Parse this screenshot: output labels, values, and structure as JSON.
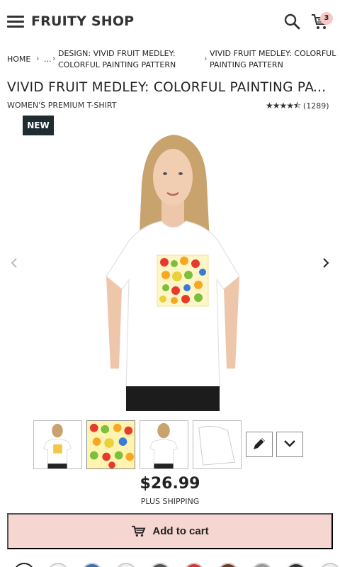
{
  "header": {
    "brand": "FRUITY SHOP",
    "cart_count": "3",
    "icons": [
      "hamburger-menu-icon",
      "search-icon",
      "cart-icon"
    ]
  },
  "breadcrumb": {
    "items": [
      "HOME",
      "...",
      "DESIGN: VIVID FRUIT MEDLEY: COLORFUL PAINTING PATTERN",
      "VIVID FRUIT MEDLEY: COLORFUL PAINTING PATTERN"
    ],
    "item2_line1": "DESIGN: VIVID FRUIT MEDLEY:",
    "item2_line2": "COLORFUL PAINTING PATTERN",
    "item3_line1": "VIVID FRUIT MEDLEY: COLORFUL",
    "item3_line2": "PAINTING PATTERN"
  },
  "product": {
    "title": "VIVID FRUIT MEDLEY: COLORFUL PAINTING PATTE...",
    "subtitle": "WOMEN'S PREMIUM T-SHIRT",
    "rating": 4.5,
    "rating_count": "(1289)",
    "badge": "NEW",
    "price": "$26.99",
    "shipping": "PLUS SHIPPING",
    "add_to_cart": "Add to cart"
  },
  "colors": {
    "accent": "#f6d6d0",
    "badge_bg": "#1f2d33"
  }
}
